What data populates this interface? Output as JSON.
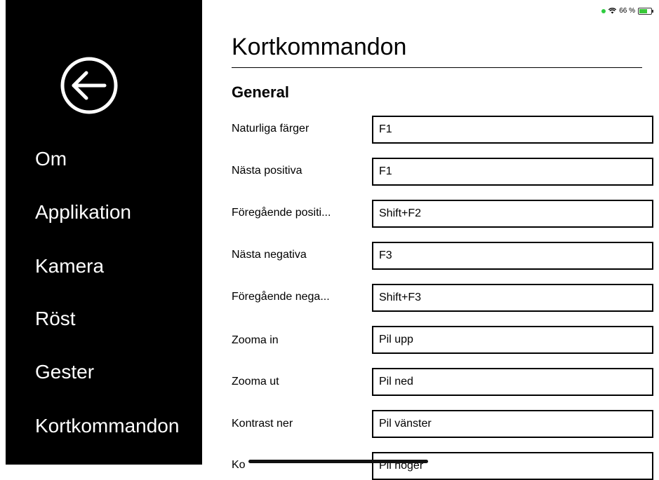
{
  "status": {
    "battery_text": "66 %",
    "dot_color": "#2ecc40"
  },
  "sidebar": {
    "back_icon": "back-arrow-circle-icon",
    "items": [
      {
        "label": "Om"
      },
      {
        "label": "Applikation"
      },
      {
        "label": "Kamera"
      },
      {
        "label": "Röst"
      },
      {
        "label": "Gester"
      },
      {
        "label": "Kortkommandon"
      }
    ]
  },
  "main": {
    "title": "Kortkommandon",
    "section": "General",
    "rows": [
      {
        "label": "Naturliga färger",
        "value": "F1"
      },
      {
        "label": "Nästa positiva",
        "value": "F1"
      },
      {
        "label": "Föregående positi...",
        "value": "Shift+F2"
      },
      {
        "label": "Nästa negativa",
        "value": "F3"
      },
      {
        "label": "Föregående nega...",
        "value": "Shift+F3"
      },
      {
        "label": "Zooma in",
        "value": "Pil upp"
      },
      {
        "label": "Zooma ut",
        "value": "Pil ned"
      },
      {
        "label": "Kontrast ner",
        "value": "Pil vänster"
      },
      {
        "label": "Ko",
        "value": "Pil höger"
      }
    ]
  },
  "colors": {
    "sidebar_bg": "#000000",
    "sidebar_text": "#ffffff",
    "main_bg": "#ffffff"
  }
}
